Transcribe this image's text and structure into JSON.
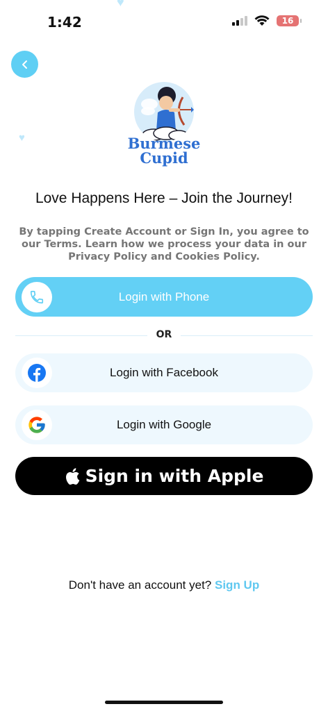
{
  "status_bar": {
    "time": "1:42",
    "battery": "16"
  },
  "logo": {
    "line1": "Burmese",
    "line2": "Cupid"
  },
  "headline": "Love Happens Here – Join the Journey!",
  "disclaimer": "By tapping Create Account or Sign In, you agree to our Terms. Learn how we process your data in our Privacy Policy and Cookies Policy.",
  "buttons": {
    "phone": "Login with Phone",
    "facebook": "Login with Facebook",
    "google": "Login with Google",
    "apple": "Sign in with Apple"
  },
  "divider_text": "OR",
  "footer": {
    "prompt": "Don't have an account yet?",
    "link": "Sign Up"
  },
  "icons": {
    "back": "chevron-left-icon",
    "phone": "phone-icon",
    "facebook": "facebook-icon",
    "google": "google-icon",
    "apple": "apple-icon"
  },
  "colors": {
    "accent": "#5fcff4",
    "soft": "#eef8fe",
    "facebook": "#1877f2"
  }
}
